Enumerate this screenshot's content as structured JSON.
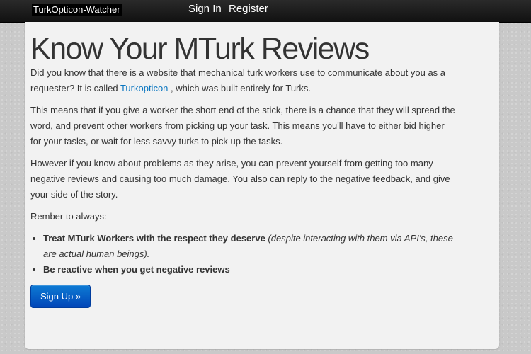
{
  "navbar": {
    "brand": "TurkOpticon-Watcher",
    "links": [
      "Sign In",
      "Register"
    ]
  },
  "hero": {
    "title": "Know Your MTurk Reviews",
    "p1_before": "Did you know that there is a website that mechanical turk workers use to communicate about you as a requester? It is called",
    "p1_link": "Turkopticon",
    "p1_after": ", which was built entirely for Turks.",
    "p2": "This means that if you give a worker the short end of the stick, there is a chance that they will spread the word, and prevent other workers from picking up your task. This means you'll have to either bid higher for your tasks, or wait for less savvy turks to pick up the tasks.",
    "p3": "However if you know about problems as they arise, you can prevent yourself from getting too many negative reviews and causing too much damage. You also can reply to the negative feedback, and give your side of the story.",
    "p4": "Rember to always:",
    "bullets": [
      {
        "bold": "Treat MTurk Workers with the respect they deserve",
        "italic": "(despite interacting with them via API's, these are actual human beings)."
      },
      {
        "bold": "Be reactive when you get negative reviews",
        "italic": ""
      }
    ],
    "cta": "Sign Up »"
  }
}
